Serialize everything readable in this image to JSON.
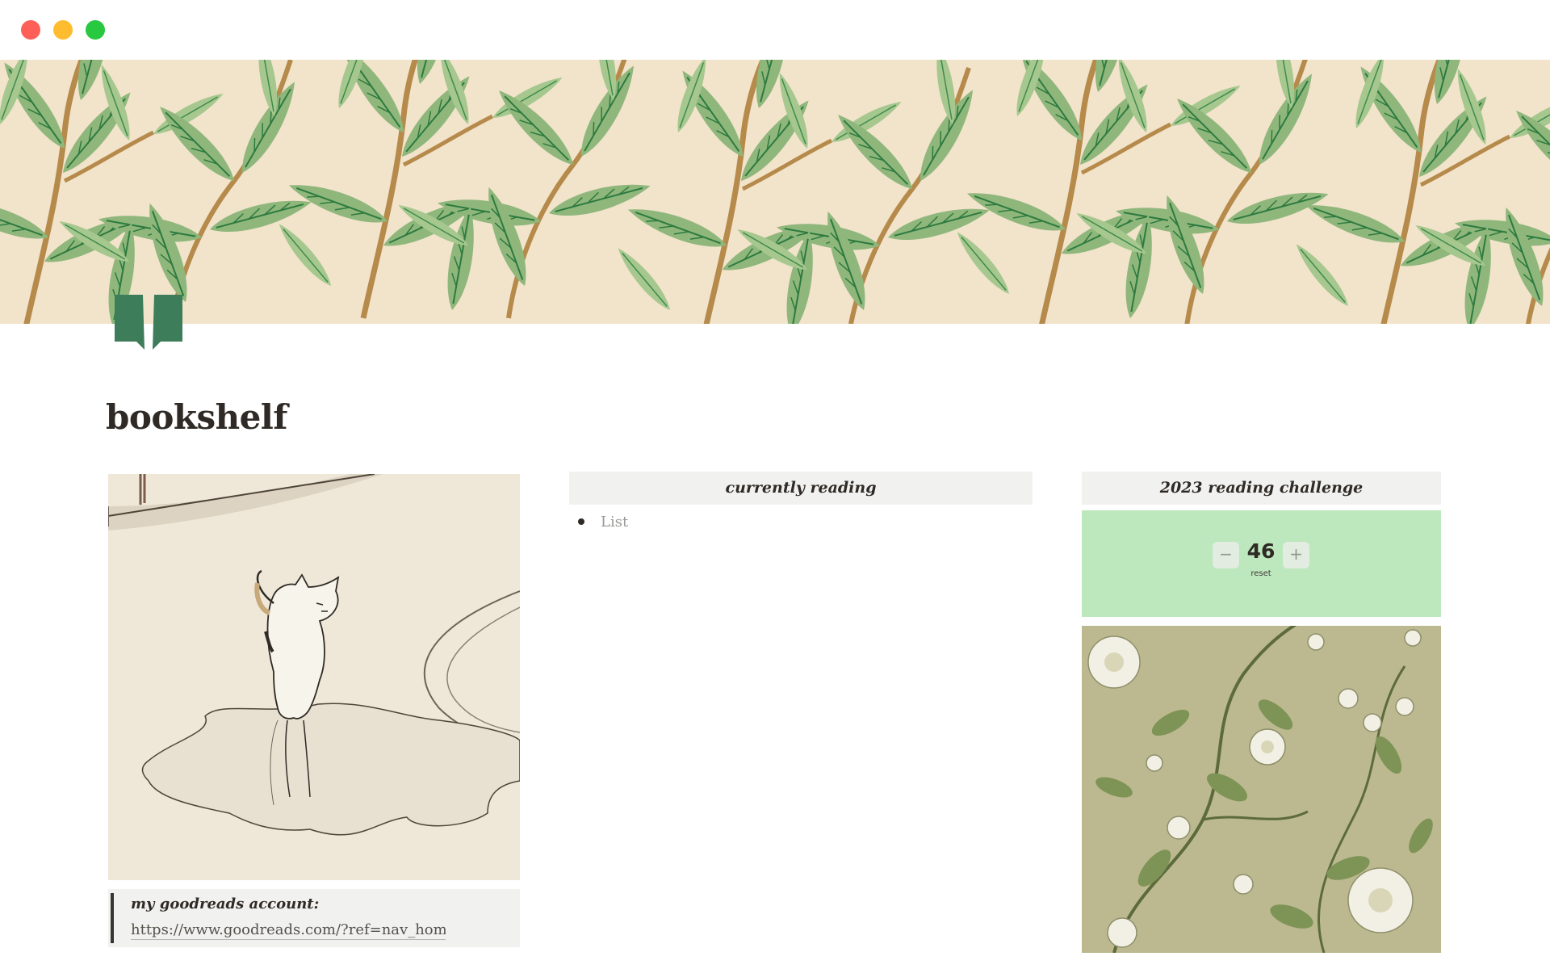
{
  "window": {
    "controls": [
      "close",
      "minimize",
      "maximize"
    ]
  },
  "cover": {
    "icon": "willow-leaf-pattern",
    "colors": {
      "background": "#f2e3cb",
      "leaf": "#8fb77c",
      "leaf_dark": "#2d7a3e",
      "stem": "#b58a4a"
    }
  },
  "page": {
    "icon": "open-book-icon",
    "icon_color": "#3d7d5a",
    "title": "bookshelf"
  },
  "left_column": {
    "image": "cat-reflection-sketch",
    "callout": {
      "label": "my goodreads account:",
      "link": "https://www.goodreads.com/?ref=nav_hom"
    }
  },
  "middle_column": {
    "header": "currently reading",
    "list": [
      {
        "text": "List"
      }
    ]
  },
  "right_column": {
    "header": "2023 reading challenge",
    "counter": {
      "value": "46",
      "decrement": "−",
      "increment": "+",
      "reset": "reset",
      "background": "#bde7bd"
    },
    "image": "floral-wallpaper"
  }
}
